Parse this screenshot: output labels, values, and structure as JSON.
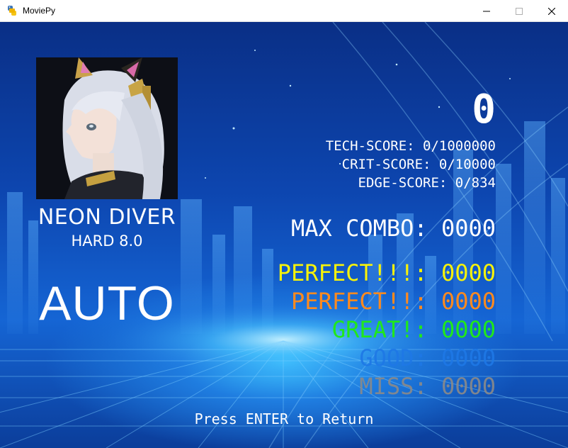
{
  "window": {
    "title": "MoviePy"
  },
  "song": {
    "name": "NEON DIVER",
    "difficulty": "HARD 8.0",
    "mode": "AUTO"
  },
  "score": {
    "main": "0",
    "tech": "TECH-SCORE: 0/1000000",
    "crit": "CRIT-SCORE: 0/10000",
    "edge": "EDGE-SCORE: 0/834",
    "max_combo": "MAX COMBO: 0000"
  },
  "judgements": {
    "perfect_plus": "PERFECT!!!: 0000",
    "perfect": "PERFECT!!: 0000",
    "great": "GREAT!: 0000",
    "good": "GOOD: 0000",
    "miss": "MISS: 0000"
  },
  "footer": {
    "hint": "Press ENTER to Return"
  },
  "colors": {
    "perfect_plus": "#f6f20a",
    "perfect": "#ff8a1e",
    "great": "#21e81a",
    "good": "#1e78e6",
    "miss": "#8a8a8a"
  },
  "icons": {
    "app": "python-snake-icon",
    "minimize": "minimize-icon",
    "maximize": "maximize-icon",
    "close": "close-icon"
  }
}
